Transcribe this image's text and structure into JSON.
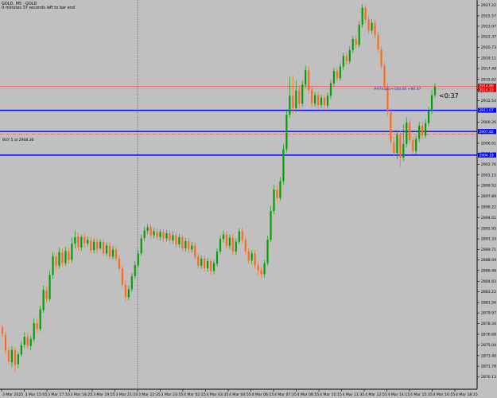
{
  "header": {
    "line1": "GOLD, M5 : GOLD",
    "line2": "0 minutes 37 seconds left to bar end"
  },
  "order_labels": {
    "buy": "BUY 5 at 2908.36",
    "buy_line_text": "#974 pcv+100.00 +80.37",
    "timer": "<0:37"
  },
  "chart_data": {
    "type": "candlestick",
    "title": "",
    "xlabel": "",
    "ylabel": "",
    "ylim": [
      2868.25,
      2928.0
    ],
    "price_ticks": [
      "2927.22",
      "2925.57",
      "2923.97",
      "2922.37",
      "2920.73",
      "2919.11",
      "2917.48",
      "2915.82",
      "2914.23",
      "2912.54",
      "2910.91",
      "2909.26",
      "2907.61",
      "2906.01",
      "2904.41",
      "2902.76",
      "2901.15",
      "2899.52",
      "2897.89",
      "2896.22",
      "2894.61",
      "2892.95",
      "2891.33",
      "2889.71",
      "2888.09",
      "2886.48",
      "2884.83",
      "2883.22",
      "2881.56",
      "2879.97",
      "2878.34",
      "2876.68",
      "2875.04",
      "2873.40",
      "2871.78",
      "2870.13"
    ],
    "time_ticks": [
      "3 Mar 2025",
      "3 Mar 15:05",
      "3 Mar 17:10",
      "3 Mar 18:25",
      "3 Mar 19:55",
      "3 Mar 21:10",
      "3 Mar 22:35",
      "3 Mar 23:55",
      "4 Mar 02:15",
      "4 Mar 03:35",
      "4 Mar 04:55",
      "4 Mar 06:15",
      "4 Mar 07:35",
      "4 Mar 08:55",
      "4 Mar 10:15",
      "4 Mar 11:35",
      "4 Mar 12:55",
      "4 Mar 14:15",
      "4 Mar 15:35",
      "4 Mar 16:55",
      "4 Mar 18:15"
    ],
    "price_markers": [
      {
        "price": "2914.80",
        "color": "#e00000"
      },
      {
        "price": "2914.23",
        "color": "#e00000"
      },
      {
        "price": "2911.07",
        "color": "#0000ff"
      },
      {
        "price": "2907.82",
        "color": "#0000ff"
      },
      {
        "price": "2904.19",
        "color": "#0000ff"
      }
    ],
    "hlines": [
      {
        "price": 2914.75,
        "color": "#ff4040",
        "style": "solid"
      },
      {
        "price": 2914.35,
        "color": "#ff8080",
        "style": "solid"
      },
      {
        "price": 2911.07,
        "color": "#0000ff",
        "style": "solid"
      },
      {
        "price": 2907.82,
        "color": "#0000ff",
        "style": "solid"
      },
      {
        "price": 2907.42,
        "color": "#ff4040",
        "style": "dashdot"
      },
      {
        "price": 2904.19,
        "color": "#0000ff",
        "style": "solid"
      }
    ],
    "vline_time": "3 Mar 22:35",
    "colors": {
      "bull": "#00a000",
      "bear": "#ff6a1a",
      "background": "#c0c0c0",
      "axis": "#000000"
    },
    "candles": [
      [
        2877.8,
        2876.7,
        2878.2,
        2876.2
      ],
      [
        2876.6,
        2874.2,
        2877.1,
        2873.6
      ],
      [
        2874.2,
        2872.5,
        2874.8,
        2872.0
      ],
      [
        2872.4,
        2874.3,
        2874.9,
        2871.6
      ],
      [
        2874.3,
        2872.0,
        2874.7,
        2870.9
      ],
      [
        2872.1,
        2873.6,
        2874.0,
        2871.5
      ],
      [
        2873.6,
        2875.0,
        2875.6,
        2873.2
      ],
      [
        2875.1,
        2876.3,
        2877.0,
        2874.6
      ],
      [
        2876.3,
        2874.9,
        2876.9,
        2874.5
      ],
      [
        2874.9,
        2876.0,
        2876.5,
        2874.3
      ],
      [
        2875.9,
        2878.4,
        2879.2,
        2875.5
      ],
      [
        2878.4,
        2877.5,
        2879.0,
        2877.0
      ],
      [
        2877.5,
        2880.5,
        2881.1,
        2877.1
      ],
      [
        2880.4,
        2883.5,
        2884.2,
        2880.0
      ],
      [
        2883.4,
        2882.1,
        2884.0,
        2881.6
      ],
      [
        2882.1,
        2885.8,
        2886.4,
        2881.7
      ],
      [
        2885.8,
        2888.7,
        2889.3,
        2885.2
      ],
      [
        2888.6,
        2887.2,
        2889.1,
        2886.6
      ],
      [
        2887.2,
        2889.3,
        2890.0,
        2886.8
      ],
      [
        2889.2,
        2887.6,
        2889.8,
        2887.1
      ],
      [
        2887.6,
        2889.5,
        2890.1,
        2887.2
      ],
      [
        2889.4,
        2888.1,
        2889.9,
        2887.5
      ],
      [
        2888.1,
        2890.6,
        2891.5,
        2887.7
      ],
      [
        2890.6,
        2891.6,
        2892.6,
        2889.9
      ],
      [
        2891.7,
        2890.1,
        2892.2,
        2889.5
      ],
      [
        2890.0,
        2891.6,
        2892.0,
        2889.5
      ],
      [
        2891.6,
        2890.7,
        2892.1,
        2890.1
      ],
      [
        2890.6,
        2891.2,
        2891.7,
        2890.2
      ],
      [
        2891.1,
        2889.6,
        2891.6,
        2889.1
      ],
      [
        2889.6,
        2890.9,
        2891.4,
        2889.1
      ],
      [
        2890.9,
        2889.8,
        2891.4,
        2889.2
      ],
      [
        2889.9,
        2890.9,
        2891.3,
        2889.6
      ],
      [
        2890.9,
        2889.1,
        2891.3,
        2888.7
      ],
      [
        2889.1,
        2890.3,
        2890.8,
        2888.7
      ],
      [
        2890.3,
        2888.6,
        2890.9,
        2888.2
      ],
      [
        2888.6,
        2889.7,
        2890.2,
        2888.2
      ],
      [
        2889.7,
        2888.3,
        2890.2,
        2887.9
      ],
      [
        2888.3,
        2886.7,
        2888.8,
        2886.2
      ],
      [
        2886.8,
        2884.3,
        2887.2,
        2883.7
      ],
      [
        2884.3,
        2882.4,
        2884.9,
        2881.8
      ],
      [
        2882.4,
        2883.6,
        2884.2,
        2881.9
      ],
      [
        2883.6,
        2885.6,
        2886.1,
        2883.2
      ],
      [
        2885.6,
        2887.3,
        2887.9,
        2885.2
      ],
      [
        2887.3,
        2889.1,
        2889.6,
        2886.9
      ],
      [
        2889.1,
        2891.4,
        2892.0,
        2888.7
      ],
      [
        2891.5,
        2892.6,
        2893.2,
        2891.0
      ],
      [
        2892.6,
        2893.1,
        2893.6,
        2892.1
      ],
      [
        2893.2,
        2891.9,
        2893.7,
        2891.4
      ],
      [
        2891.9,
        2892.5,
        2893.0,
        2891.4
      ],
      [
        2892.4,
        2891.6,
        2892.9,
        2891.1
      ],
      [
        2891.6,
        2892.4,
        2892.8,
        2891.1
      ],
      [
        2892.4,
        2891.4,
        2892.9,
        2890.9
      ],
      [
        2891.4,
        2892.2,
        2892.7,
        2890.9
      ],
      [
        2892.2,
        2891.1,
        2892.7,
        2890.6
      ],
      [
        2891.1,
        2891.9,
        2892.5,
        2890.6
      ],
      [
        2891.9,
        2890.5,
        2892.3,
        2890.0
      ],
      [
        2890.5,
        2891.6,
        2892.1,
        2890.0
      ],
      [
        2891.6,
        2889.9,
        2892.0,
        2889.4
      ],
      [
        2889.9,
        2891.0,
        2891.5,
        2889.4
      ],
      [
        2891.0,
        2889.7,
        2891.5,
        2889.2
      ],
      [
        2889.7,
        2890.3,
        2890.9,
        2889.2
      ],
      [
        2890.3,
        2888.6,
        2890.8,
        2888.1
      ],
      [
        2888.6,
        2887.2,
        2889.1,
        2886.7
      ],
      [
        2887.2,
        2888.3,
        2888.8,
        2886.7
      ],
      [
        2888.3,
        2886.8,
        2888.8,
        2886.3
      ],
      [
        2886.8,
        2887.9,
        2888.4,
        2886.3
      ],
      [
        2887.9,
        2886.4,
        2888.3,
        2885.8
      ],
      [
        2886.4,
        2887.6,
        2888.1,
        2885.9
      ],
      [
        2887.5,
        2889.4,
        2889.9,
        2887.1
      ],
      [
        2889.4,
        2891.3,
        2891.9,
        2889.0
      ],
      [
        2891.3,
        2892.0,
        2892.6,
        2890.8
      ],
      [
        2892.0,
        2890.3,
        2892.5,
        2889.8
      ],
      [
        2890.3,
        2891.5,
        2892.0,
        2889.8
      ],
      [
        2891.5,
        2889.4,
        2892.0,
        2888.9
      ],
      [
        2889.4,
        2890.9,
        2891.4,
        2888.9
      ],
      [
        2890.9,
        2892.5,
        2893.0,
        2890.5
      ],
      [
        2892.5,
        2891.2,
        2893.1,
        2890.7
      ],
      [
        2891.2,
        2889.4,
        2891.7,
        2888.9
      ],
      [
        2889.4,
        2888.0,
        2889.9,
        2887.5
      ],
      [
        2888.0,
        2889.1,
        2889.6,
        2887.5
      ],
      [
        2889.1,
        2887.3,
        2889.6,
        2886.8
      ],
      [
        2887.3,
        2886.5,
        2887.8,
        2885.7
      ],
      [
        2886.5,
        2885.9,
        2887.0,
        2885.3
      ],
      [
        2885.9,
        2887.6,
        2888.1,
        2885.4
      ],
      [
        2887.6,
        2891.2,
        2891.8,
        2887.2
      ],
      [
        2891.2,
        2895.6,
        2896.4,
        2890.8
      ],
      [
        2895.6,
        2898.9,
        2899.6,
        2895.1
      ],
      [
        2898.9,
        2897.6,
        2899.5,
        2897.1
      ],
      [
        2897.6,
        2900.2,
        2900.8,
        2897.2
      ],
      [
        2900.2,
        2905.1,
        2905.9,
        2899.7
      ],
      [
        2905.1,
        2910.4,
        2911.2,
        2904.6
      ],
      [
        2910.4,
        2913.3,
        2916.2,
        2909.9
      ],
      [
        2913.3,
        2911.4,
        2916.4,
        2910.6
      ],
      [
        2911.4,
        2914.1,
        2915.7,
        2910.8
      ],
      [
        2914.1,
        2912.1,
        2914.9,
        2911.3
      ],
      [
        2912.1,
        2915.0,
        2915.6,
        2911.6
      ],
      [
        2915.0,
        2917.2,
        2917.9,
        2914.5
      ],
      [
        2917.2,
        2914.2,
        2917.8,
        2913.6
      ],
      [
        2914.2,
        2912.1,
        2914.7,
        2911.5
      ],
      [
        2912.1,
        2913.4,
        2913.9,
        2911.6
      ],
      [
        2913.4,
        2911.9,
        2913.9,
        2911.3
      ],
      [
        2911.9,
        2913.0,
        2913.5,
        2911.4
      ],
      [
        2913.0,
        2911.8,
        2913.5,
        2911.2
      ],
      [
        2911.8,
        2913.3,
        2913.8,
        2911.4
      ],
      [
        2913.3,
        2915.2,
        2915.7,
        2912.8
      ],
      [
        2915.2,
        2917.1,
        2917.6,
        2914.8
      ],
      [
        2917.1,
        2916.0,
        2917.7,
        2915.5
      ],
      [
        2916.0,
        2917.8,
        2918.3,
        2915.6
      ],
      [
        2917.8,
        2919.4,
        2919.9,
        2917.3
      ],
      [
        2919.4,
        2918.6,
        2919.9,
        2918.1
      ],
      [
        2918.6,
        2920.3,
        2920.9,
        2918.2
      ],
      [
        2920.3,
        2922.0,
        2922.5,
        2919.8
      ],
      [
        2922.0,
        2921.1,
        2922.6,
        2920.6
      ],
      [
        2921.1,
        2924.2,
        2924.8,
        2920.7
      ],
      [
        2924.2,
        2926.8,
        2927.4,
        2923.7
      ],
      [
        2926.8,
        2925.0,
        2927.2,
        2924.5
      ],
      [
        2925.0,
        2923.3,
        2925.5,
        2922.8
      ],
      [
        2923.3,
        2924.5,
        2925.1,
        2922.8
      ],
      [
        2924.5,
        2922.6,
        2925.0,
        2922.1
      ],
      [
        2922.6,
        2920.4,
        2923.1,
        2919.9
      ],
      [
        2920.4,
        2917.9,
        2920.9,
        2917.4
      ],
      [
        2917.9,
        2914.7,
        2918.4,
        2914.2
      ],
      [
        2914.7,
        2910.8,
        2915.2,
        2910.2
      ],
      [
        2910.8,
        2906.2,
        2911.3,
        2905.7
      ],
      [
        2906.2,
        2904.5,
        2907.0,
        2903.9
      ],
      [
        2904.5,
        2907.3,
        2908.0,
        2903.5
      ],
      [
        2907.3,
        2903.8,
        2907.9,
        2902.4
      ],
      [
        2903.8,
        2905.9,
        2908.9,
        2903.3
      ],
      [
        2905.9,
        2909.2,
        2910.0,
        2905.4
      ],
      [
        2909.2,
        2906.5,
        2909.7,
        2906.0
      ],
      [
        2906.5,
        2904.8,
        2907.0,
        2904.3
      ],
      [
        2904.8,
        2906.7,
        2907.2,
        2904.3
      ],
      [
        2906.7,
        2908.7,
        2909.3,
        2906.2
      ],
      [
        2908.7,
        2907.2,
        2909.3,
        2906.7
      ],
      [
        2907.2,
        2909.1,
        2909.7,
        2906.8
      ],
      [
        2909.1,
        2911.0,
        2911.6,
        2908.6
      ],
      [
        2911.0,
        2913.4,
        2914.2,
        2910.5
      ],
      [
        2913.4,
        2914.7,
        2915.2,
        2913.0
      ]
    ]
  }
}
